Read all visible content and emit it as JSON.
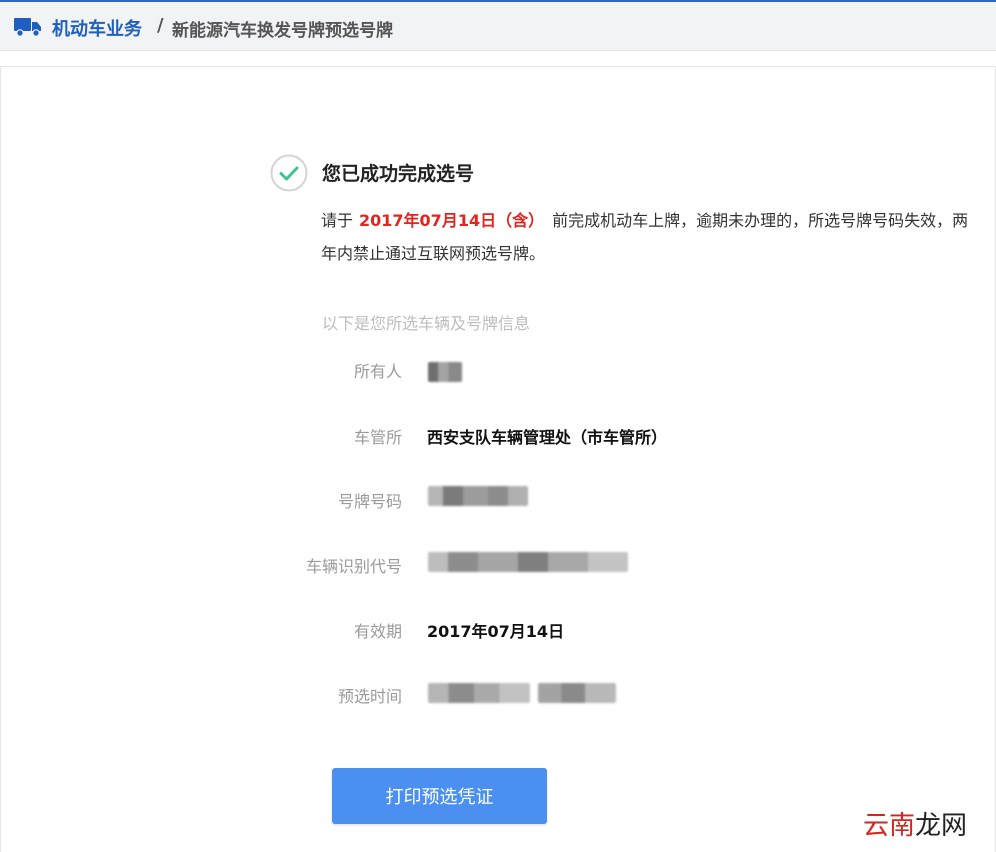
{
  "header": {
    "breadcrumb_main": "机动车业务",
    "breadcrumb_separator": "/",
    "breadcrumb_sub": "新能源汽车换发号牌预选号牌",
    "accent_color": "#1f5fbf",
    "icon": "truck-icon"
  },
  "result": {
    "icon": "check-circle-icon",
    "title": "您已成功完成选号",
    "notice_prefix": "请于",
    "notice_deadline": "2017年07月14日（含）",
    "notice_suffix": "前完成机动车上牌，逾期未办理的，所选号牌号码失效，两年内禁止通过互联网预选号牌。",
    "deadline_color": "#e5231d"
  },
  "info": {
    "caption": "以下是您所选车辆及号牌信息",
    "rows": [
      {
        "label": "所有人",
        "value": ""
      },
      {
        "label": "车管所",
        "value": "西安支队车辆管理处（市车管所）"
      },
      {
        "label": "号牌号码",
        "value": ""
      },
      {
        "label": "车辆识别代号",
        "value": ""
      },
      {
        "label": "有效期",
        "value": "2017年07月14日"
      },
      {
        "label": "预选时间",
        "value": ""
      }
    ]
  },
  "actions": {
    "print_label": "打印预选凭证",
    "button_color": "#4b8ff0"
  },
  "watermark": {
    "part1": "云南",
    "part2": "龙网"
  }
}
